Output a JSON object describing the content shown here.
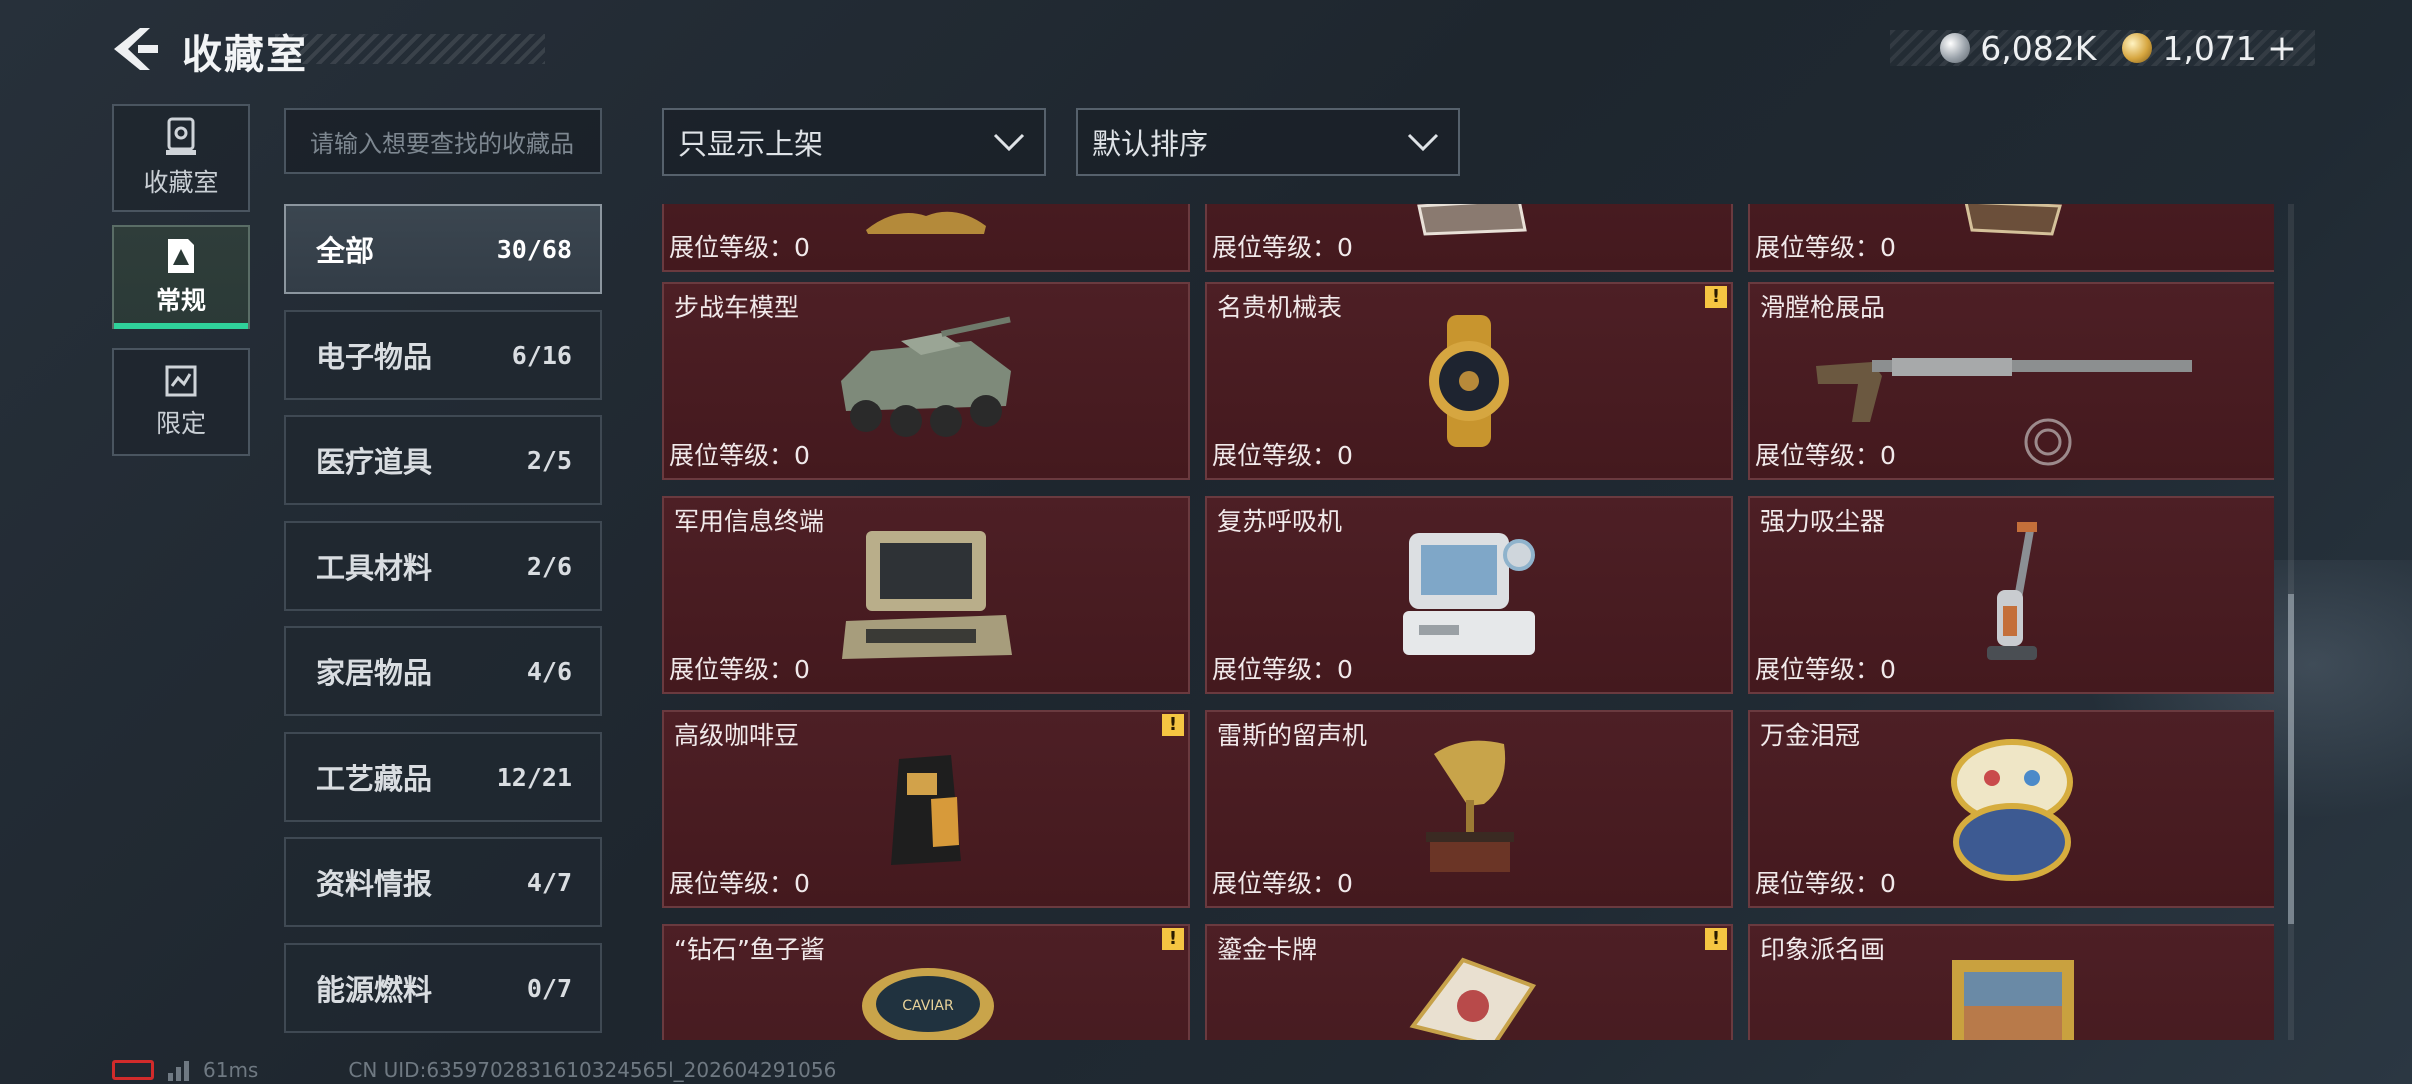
{
  "header": {
    "title": "收藏室",
    "currency_silver": "6,082K",
    "currency_gold": "1,071",
    "plus_label": "+"
  },
  "side_tabs": [
    {
      "label": "收藏室",
      "icon": "trophy-case-icon"
    },
    {
      "label": "常规",
      "icon": "gallery-triangle-icon",
      "active": true
    },
    {
      "label": "限定",
      "icon": "limited-map-icon"
    }
  ],
  "search": {
    "placeholder": "请输入想要查找的收藏品"
  },
  "filters": {
    "show_filter": "只显示上架",
    "sort": "默认排序"
  },
  "categories": [
    {
      "name": "全部",
      "count": "30/68",
      "active": true
    },
    {
      "name": "电子物品",
      "count": "6/16"
    },
    {
      "name": "医疗道具",
      "count": "2/5"
    },
    {
      "name": "工具材料",
      "count": "2/6"
    },
    {
      "name": "家居物品",
      "count": "4/6"
    },
    {
      "name": "工艺藏品",
      "count": "12/21"
    },
    {
      "name": "资料情报",
      "count": "4/7"
    },
    {
      "name": "能源燃料",
      "count": "0/7"
    }
  ],
  "items": [
    {
      "name": "",
      "level": "展位等级：0",
      "warn": false
    },
    {
      "name": "",
      "level": "展位等级：0",
      "warn": false
    },
    {
      "name": "",
      "level": "展位等级：0",
      "warn": false
    },
    {
      "name": "步战车模型",
      "level": "展位等级：0",
      "warn": false
    },
    {
      "name": "名贵机械表",
      "level": "展位等级：0",
      "warn": true
    },
    {
      "name": "滑膛枪展品",
      "level": "展位等级：0",
      "warn": false
    },
    {
      "name": "军用信息终端",
      "level": "展位等级：0",
      "warn": false
    },
    {
      "name": "复苏呼吸机",
      "level": "展位等级：0",
      "warn": false
    },
    {
      "name": "强力吸尘器",
      "level": "展位等级：0",
      "warn": false
    },
    {
      "name": "高级咖啡豆",
      "level": "展位等级：0",
      "warn": true
    },
    {
      "name": "雷斯的留声机",
      "level": "展位等级：0",
      "warn": false
    },
    {
      "name": "万金泪冠",
      "level": "展位等级：0",
      "warn": false
    },
    {
      "name": "“钻石”鱼子酱",
      "level": "",
      "warn": true
    },
    {
      "name": "鎏金卡牌",
      "level": "",
      "warn": true
    },
    {
      "name": "印象派名画",
      "level": "",
      "warn": false
    }
  ],
  "caviar_label": "CAVIAR",
  "footer": {
    "ping": "61ms",
    "uid": "CN UID:6359702831610324565l_202604291056"
  },
  "colors": {
    "card_bg": "#4d1f25",
    "accent": "#2fd19a",
    "warning": "#f5c542"
  }
}
